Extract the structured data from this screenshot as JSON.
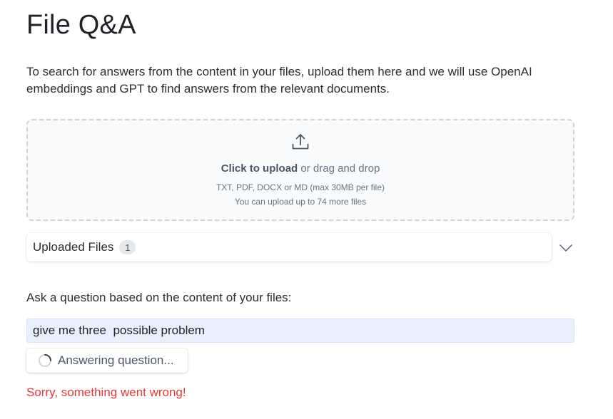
{
  "page": {
    "title": "File Q&A",
    "intro": "To search for answers from the content in your files, upload them here and we will use OpenAI embeddings and GPT to find answers from the relevant documents."
  },
  "upload": {
    "icon": "upload-icon",
    "click_text": "Click to upload",
    "drag_text": " or drag and drop",
    "formats": "TXT, PDF, DOCX or MD (max 30MB per file)",
    "remaining": "You can upload up to 74 more files"
  },
  "files": {
    "label": "Uploaded Files",
    "count": "1",
    "toggle_icon": "chevron-down-icon"
  },
  "question": {
    "label": "Ask a question based on the content of your files:",
    "value": "give me three  possible problem"
  },
  "answer_button": {
    "label": "Answering question...",
    "icon": "spinner-icon"
  },
  "error": {
    "message": "Sorry, something went wrong!"
  },
  "colors": {
    "error": "#e53935",
    "input_bg": "#e8f0fe",
    "badge_bg": "#e5e7eb"
  }
}
